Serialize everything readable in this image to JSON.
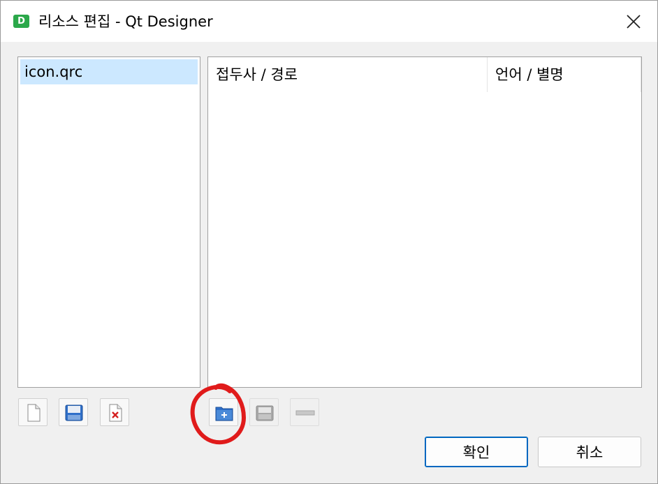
{
  "window": {
    "title": "리소스 편집 - Qt Designer",
    "app_icon_letter": "D",
    "icon_name": "qt-designer-app-icon"
  },
  "resource_files": {
    "items": [
      {
        "label": "icon.qrc",
        "selected": true
      }
    ]
  },
  "resources_table": {
    "columns": [
      {
        "label": "접두사 / 경로"
      },
      {
        "label": "언어 / 별명"
      }
    ],
    "rows": []
  },
  "file_toolbar": {
    "buttons": [
      {
        "icon": "new-file-icon",
        "enabled": true
      },
      {
        "icon": "save-icon",
        "enabled": true
      },
      {
        "icon": "remove-file-icon",
        "enabled": true
      }
    ]
  },
  "resource_toolbar": {
    "buttons": [
      {
        "icon": "add-prefix-folder-icon",
        "enabled": true
      },
      {
        "icon": "add-files-icon",
        "enabled": false
      },
      {
        "icon": "remove-icon",
        "enabled": false
      }
    ]
  },
  "dialog_buttons": {
    "ok_label": "확인",
    "cancel_label": "취소"
  },
  "colors": {
    "selection": "#cce8ff",
    "accent": "#0067c0",
    "annotation": "#e01b1b",
    "app_icon": "#2ba84a"
  }
}
